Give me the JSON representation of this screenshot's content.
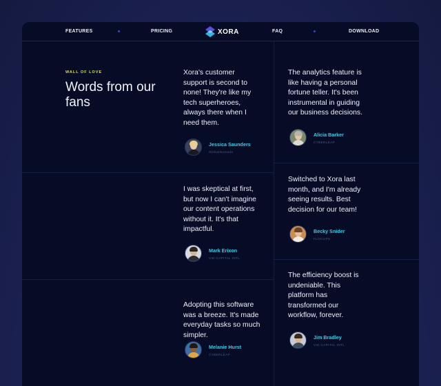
{
  "nav": {
    "features": "FEATURES",
    "pricing": "PRICING",
    "logo_text": "XORA",
    "faq": "FAQ",
    "download": "DOWNLOAD"
  },
  "section": {
    "eyebrow": "WALL OF LOVE",
    "title": "Words from our fans"
  },
  "testimonials": [
    {
      "quote": "Xora's customer support is second to none! They're like my tech superheroes, always there when I need them.",
      "name": "Jessica Saunders",
      "company": "GlobalNomads",
      "avatar": "woman-blonde-avatar"
    },
    {
      "quote": "The analytics feature is like having a personal fortune teller. It's been instrumental in guiding our business decisions.",
      "name": "Alicia Barker",
      "company": "CYBERLEAP",
      "avatar": "woman-gray-hair-avatar"
    },
    {
      "quote": "I was skeptical at first, but now I can't imagine our content operations without it. It's that impactful.",
      "name": "Mark Erixon",
      "company": "VID CAPITAL INTL",
      "avatar": "man-dark-hair-avatar"
    },
    {
      "quote": "Switched to Xora last month, and I'm already seeing results. Best decision for our team!",
      "name": "Becky Snider",
      "company": "FLOCUPS",
      "avatar": "woman-brown-hair-avatar"
    },
    {
      "quote": "Adopting this software was a breeze. It's made everyday tasks so much simpler.",
      "name": "Melanie Hurst",
      "company": "CYBERLEAP",
      "avatar": "woman-curly-hair-avatar"
    },
    {
      "quote": "The efficiency boost is undeniable. This platform has transformed our workflow, forever.",
      "name": "Jim Bradley",
      "company": "VID CAPITAL INTL",
      "avatar": "man-short-hair-avatar"
    }
  ],
  "colors": {
    "accent_cyan": "#2fd0e6",
    "eyebrow_yellow": "#d8e04a",
    "panel_bg": "#060c26"
  }
}
